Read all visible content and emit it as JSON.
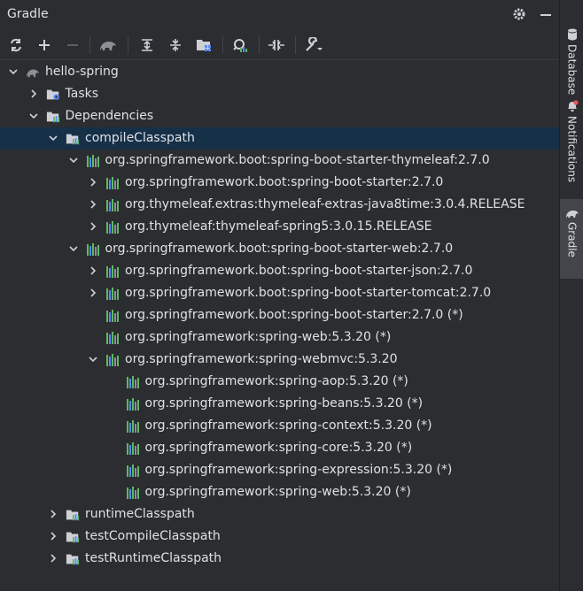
{
  "panel": {
    "title": "Gradle"
  },
  "header_icons": [
    "gear-icon",
    "minimize-icon"
  ],
  "toolbar": {
    "buttons": [
      "reload-icon",
      "add-icon",
      "remove-icon",
      "elephant-icon",
      "expand-all-icon",
      "collapse-all-icon",
      "group-modules-icon",
      "analyze-dependencies-icon",
      "toggle-offline-icon",
      "settings-wrench-icon"
    ]
  },
  "tree": [
    {
      "label": "hello-spring",
      "expanded": true,
      "icon": "gradle-elephant-icon"
    },
    {
      "label": "Tasks",
      "expanded": false,
      "icon": "tasks-folder-icon"
    },
    {
      "label": "Dependencies",
      "expanded": true,
      "icon": "dependencies-folder-icon"
    },
    {
      "label": "compileClasspath",
      "expanded": true,
      "icon": "configuration-icon",
      "selected": true
    },
    {
      "label": "org.springframework.boot:spring-boot-starter-thymeleaf:2.7.0",
      "expanded": true,
      "icon": "library-icon"
    },
    {
      "label": "org.springframework.boot:spring-boot-starter:2.7.0",
      "expanded": false,
      "icon": "library-icon"
    },
    {
      "label": "org.thymeleaf.extras:thymeleaf-extras-java8time:3.0.4.RELEASE",
      "expanded": false,
      "icon": "library-icon"
    },
    {
      "label": "org.thymeleaf:thymeleaf-spring5:3.0.15.RELEASE",
      "expanded": false,
      "icon": "library-icon"
    },
    {
      "label": "org.springframework.boot:spring-boot-starter-web:2.7.0",
      "expanded": true,
      "icon": "library-icon"
    },
    {
      "label": "org.springframework.boot:spring-boot-starter-json:2.7.0",
      "expanded": false,
      "icon": "library-icon"
    },
    {
      "label": "org.springframework.boot:spring-boot-starter-tomcat:2.7.0",
      "expanded": false,
      "icon": "library-icon"
    },
    {
      "label": "org.springframework.boot:spring-boot-starter:2.7.0 (*)",
      "icon": "library-icon"
    },
    {
      "label": "org.springframework:spring-web:5.3.20 (*)",
      "icon": "library-icon"
    },
    {
      "label": "org.springframework:spring-webmvc:5.3.20",
      "expanded": true,
      "icon": "library-icon"
    },
    {
      "label": "org.springframework:spring-aop:5.3.20 (*)",
      "icon": "library-icon"
    },
    {
      "label": "org.springframework:spring-beans:5.3.20 (*)",
      "icon": "library-icon"
    },
    {
      "label": "org.springframework:spring-context:5.3.20 (*)",
      "icon": "library-icon"
    },
    {
      "label": "org.springframework:spring-core:5.3.20 (*)",
      "icon": "library-icon"
    },
    {
      "label": "org.springframework:spring-expression:5.3.20 (*)",
      "icon": "library-icon"
    },
    {
      "label": "org.springframework:spring-web:5.3.20 (*)",
      "icon": "library-icon"
    },
    {
      "label": "runtimeClasspath",
      "expanded": false,
      "icon": "configuration-icon"
    },
    {
      "label": "testCompileClasspath",
      "expanded": false,
      "icon": "configuration-icon"
    },
    {
      "label": "testRuntimeClasspath",
      "expanded": false,
      "icon": "configuration-icon"
    }
  ],
  "right_strip": {
    "items": [
      {
        "label": "Database",
        "icon": "database-icon"
      },
      {
        "label": "Notifications",
        "icon": "bell-icon"
      },
      {
        "label": "Gradle",
        "icon": "gradle-elephant-icon",
        "active": true
      }
    ]
  },
  "colors": {
    "background": "#2b2d30",
    "selected_row": "#163048",
    "text": "#dfe1e5",
    "library_green": "#5fb865",
    "library_blue": "#548af7",
    "notification_dot": "#e55757"
  }
}
